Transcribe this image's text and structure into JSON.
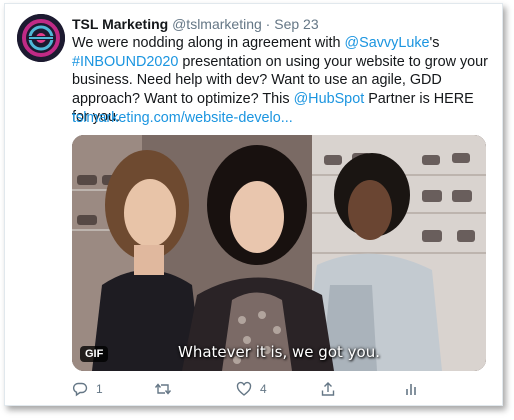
{
  "tweet": {
    "display_name": "TSL Marketing",
    "handle": "@tslmarketing",
    "separator": "·",
    "date": "Sep 23",
    "text_part1": "We were nodding along in agreement with ",
    "mention1": "@SavvyLuke",
    "text_part2": "'s ",
    "hashtag": "#INBOUND2020",
    "text_part3": " presentation on using your website to grow your business. Need help with dev? Want to use an agile, GDD approach? Want to optimize? This ",
    "mention2": "@HubSpot",
    "text_part4": " Partner is HERE for you.",
    "url": "tslmarketing.com/website-develo..."
  },
  "media": {
    "badge": "GIF",
    "caption": "Whatever it is, we got you."
  },
  "actions": {
    "reply_icon": "reply-icon",
    "reply_count": "1",
    "retweet_icon": "retweet-icon",
    "like_icon": "like-icon",
    "like_count": "4",
    "share_icon": "share-icon",
    "analytics_icon": "analytics-icon"
  },
  "colors": {
    "link": "#1b95e0",
    "muted": "#657786",
    "text": "#14171a"
  }
}
